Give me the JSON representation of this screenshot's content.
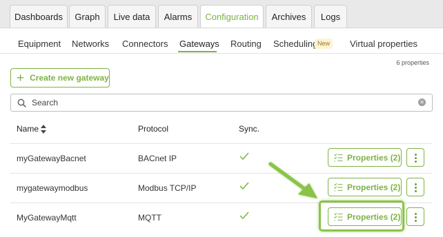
{
  "top_tabs": [
    "Dashboards",
    "Graph",
    "Live data",
    "Alarms",
    "Configuration",
    "Archives",
    "Logs"
  ],
  "active_top_tab": "Configuration",
  "sub_tabs": [
    "Equipment",
    "Networks",
    "Connectors",
    "Gateways",
    "Routing",
    "Scheduling",
    "Virtual properties"
  ],
  "active_sub_tab": "Gateways",
  "new_badge": "New",
  "properties_count": "6 properties",
  "create_button": "Create new gateway",
  "search": {
    "placeholder": "Search"
  },
  "table": {
    "headers": {
      "name": "Name",
      "protocol": "Protocol",
      "sync": "Sync."
    },
    "rows": [
      {
        "name": "myGatewayBacnet",
        "protocol": "BACnet IP",
        "properties_label": "Properties (2)"
      },
      {
        "name": "mygatewaymodbus",
        "protocol": "Modbus TCP/IP",
        "properties_label": "Properties (2)"
      },
      {
        "name": "MyGatewayMqtt",
        "protocol": "MQTT",
        "properties_label": "Properties (2)"
      }
    ]
  },
  "colors": {
    "accent": "#7cb342",
    "highlight": "#8bc34a"
  },
  "icons": [
    "plus-icon",
    "search-icon",
    "clear-icon",
    "sort-icon",
    "check-icon",
    "checklist-icon",
    "more-vertical-icon",
    "arrow-pointer"
  ]
}
